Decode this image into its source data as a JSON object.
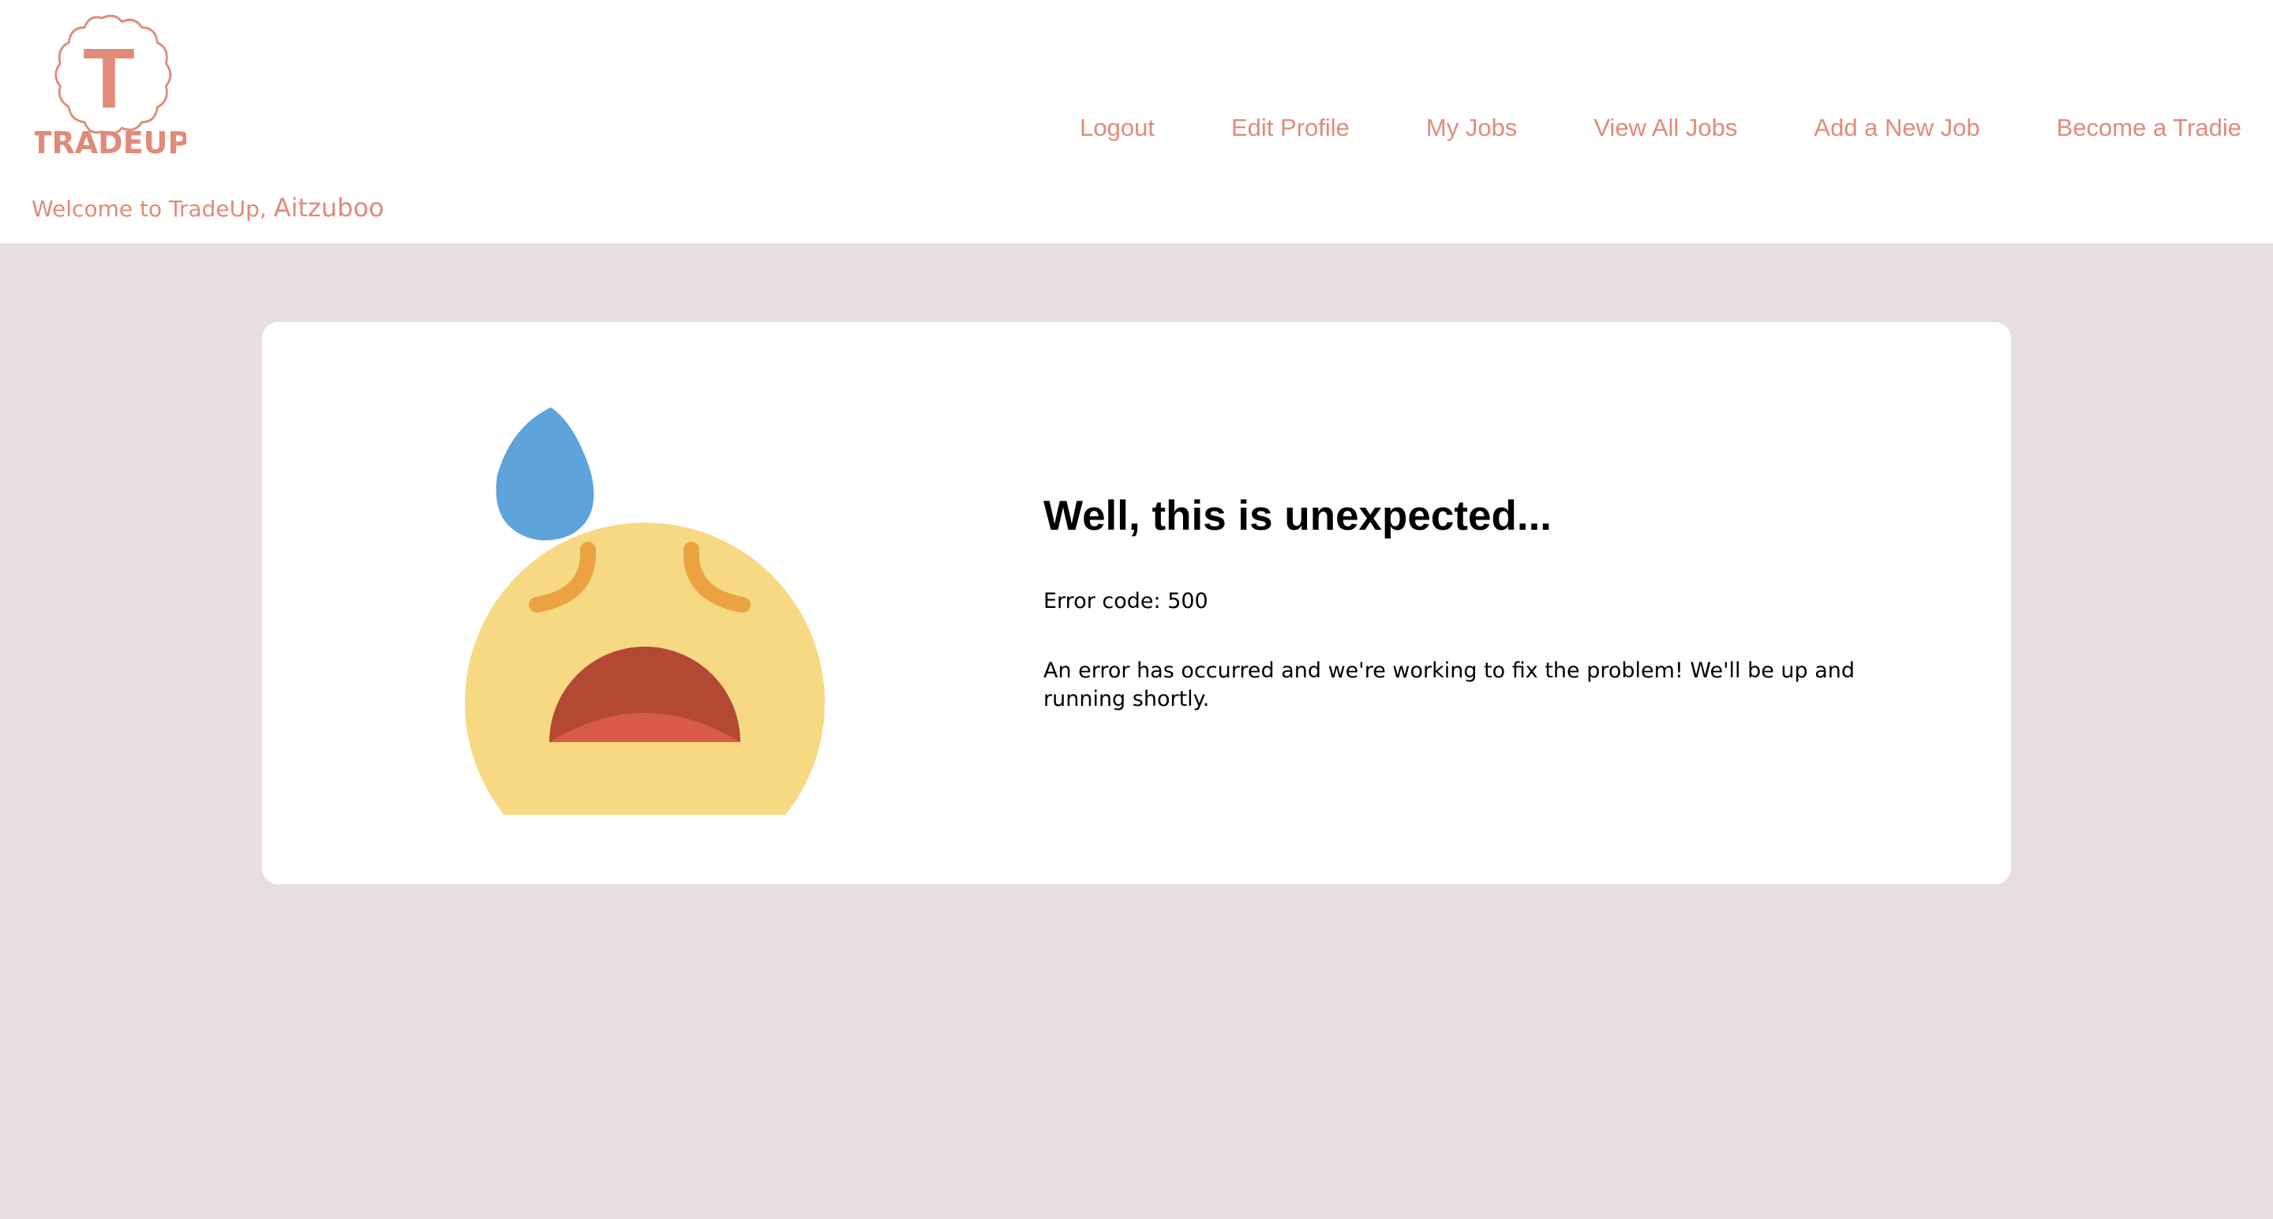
{
  "header": {
    "logo": {
      "letter": "T",
      "name": "TRADEUP"
    },
    "welcome_prefix": "Welcome to TradeUp, ",
    "username": "Aitzuboo",
    "nav": [
      {
        "label": "Logout"
      },
      {
        "label": "Edit Profile"
      },
      {
        "label": "My Jobs"
      },
      {
        "label": "View All Jobs"
      },
      {
        "label": "Add a New Job"
      },
      {
        "label": "Become a Tradie"
      }
    ]
  },
  "error": {
    "title": "Well, this is unexpected...",
    "code_text": "Error code: 500",
    "message": "An error has occurred and we're working to fix the problem! We'll be up and running shortly.",
    "illustration": "anxious-face-with-sweat-icon"
  },
  "colors": {
    "brand": "#e08b7a",
    "page_background": "#e7dfdf",
    "card_background": "#ffffff",
    "emoji_face": "#f7d983",
    "emoji_sweat": "#5ea3da",
    "emoji_mouth": "#b34834",
    "emoji_tongue": "#d95a48",
    "emoji_eyes": "#eba342"
  }
}
